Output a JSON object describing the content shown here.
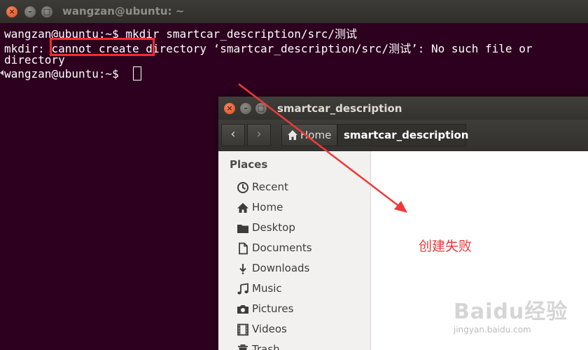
{
  "terminal": {
    "title": "wangzan@ubuntu: ~",
    "lines": [
      "wangzan@ubuntu:~$ mkdir smartcar_description/src/测试",
      "mkdir: cannot create directory ‘smartcar_description/src/测试’: No such file or",
      "directory",
      "wangzan@ubuntu:~$ "
    ]
  },
  "file_manager": {
    "title": "smartcar_description",
    "path": {
      "home_label": "Home",
      "current": "smartcar_description"
    },
    "places_heading": "Places",
    "places": [
      {
        "label": "Recent",
        "icon": "recent-icon"
      },
      {
        "label": "Home",
        "icon": "home-icon"
      },
      {
        "label": "Desktop",
        "icon": "desktop-icon"
      },
      {
        "label": "Documents",
        "icon": "documents-icon"
      },
      {
        "label": "Downloads",
        "icon": "downloads-icon"
      },
      {
        "label": "Music",
        "icon": "music-icon"
      },
      {
        "label": "Pictures",
        "icon": "pictures-icon"
      },
      {
        "label": "Videos",
        "icon": "videos-icon"
      },
      {
        "label": "Trash",
        "icon": "trash-icon"
      }
    ]
  },
  "annotation": {
    "text": "创建失败",
    "color": "#e83a3a"
  },
  "watermark": {
    "brand": "Baidu经验",
    "url": "jingyan.baidu.com"
  }
}
